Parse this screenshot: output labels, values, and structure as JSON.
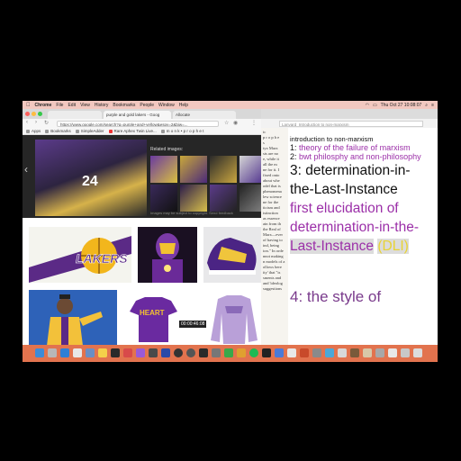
{
  "menubar": {
    "apple": "",
    "app_name": "Chrome",
    "menus": [
      "File",
      "Edit",
      "View",
      "History",
      "Bookmarks",
      "People",
      "Window",
      "Help"
    ],
    "clock": "Thu Oct 27  10:08:07"
  },
  "browser": {
    "tabs": [
      {
        "label": "purple and gold lakers - Goog",
        "active": true
      },
      {
        "label": "Allocate",
        "active": false
      }
    ],
    "url": "https://www.google.com/search?q=purple+and+yellow&espv=2&biw=...",
    "bookmarks": [
      "Apps",
      "Bookmarks",
      "SimpleAdder",
      "Rare Aphex Twin Live...",
      "m o n k • p r o p h e t"
    ],
    "related_images_title": "Related images:",
    "related_caption": "Images may be subject to copyright.   Send feedback",
    "video_time": "00:00:46:08",
    "image_texts": {
      "lakers": "LAKERS",
      "heart": "HEART"
    }
  },
  "doc": {
    "url": "Lanyard_Introduction to non-marxism",
    "scan_lines": [
      "ic",
      "p r o p h e",
      "s",
      "",
      "tyx Marx",
      "sts are no",
      "e, while it",
      "all the m",
      "ne for it. I",
      "fixed onto",
      "about whe",
      "odel that is",
      "phenomena",
      "lew science",
      "ne for the",
      "ticism and",
      "istinction",
      "as essence",
      "ain from th",
      "the Real of",
      "Marx—ever",
      "of having to",
      "ind, being",
      "ion.\" In orde",
      "nnot making",
      "n models of a",
      "ollows here",
      "ity' that \"is",
      "sments and",
      "and 'ideolog",
      "suggestions"
    ],
    "title": "introduction to non-marxism",
    "item1_num": "1: ",
    "item1_text": "theory of the failure of marxism",
    "item2_num": "2: ",
    "item2_text": "bwt philosphy and non-philosophy",
    "item3_a": "3: determination-in-",
    "item3_b": "the-Last-Instance",
    "elucidation_a": "first elucidation of",
    "elucidation_b": "determination-in-the-",
    "elucidation_c": "Last-Instance",
    "dli": "(DLI)",
    "item4": "4: the style of"
  },
  "colors": {
    "accent_purple": "#9b2fa8",
    "dli_yellow": "#e8d334",
    "dock": "#e2734e",
    "menubar": "#f2c8c0"
  }
}
